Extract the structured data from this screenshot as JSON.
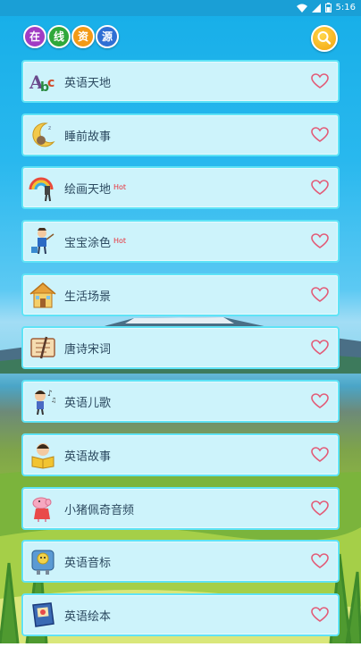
{
  "status": {
    "time": "5:16"
  },
  "header": {
    "logo_chars": [
      "在",
      "线",
      "资",
      "源"
    ],
    "logo_colors": [
      "#a13cc4",
      "#2fa83a",
      "#f29a16",
      "#2f6fd4"
    ]
  },
  "items": [
    {
      "label": "英语天地",
      "hot": "",
      "icon": "abc-letters-icon"
    },
    {
      "label": "睡前故事",
      "hot": "",
      "icon": "moon-sleep-icon"
    },
    {
      "label": "绘画天地",
      "hot": "Hot",
      "icon": "rainbow-paint-icon"
    },
    {
      "label": "宝宝涂色",
      "hot": "Hot",
      "icon": "child-paint-bucket-icon"
    },
    {
      "label": "生活场景",
      "hot": "",
      "icon": "house-icon"
    },
    {
      "label": "唐诗宋词",
      "hot": "",
      "icon": "scroll-icon"
    },
    {
      "label": "英语儿歌",
      "hot": "",
      "icon": "singing-child-icon"
    },
    {
      "label": "英语故事",
      "hot": "",
      "icon": "reading-child-icon"
    },
    {
      "label": "小猪佩奇音频",
      "hot": "",
      "icon": "peppa-pig-icon"
    },
    {
      "label": "英语音标",
      "hot": "",
      "icon": "robot-phonics-icon"
    },
    {
      "label": "英语绘本",
      "hot": "",
      "icon": "picture-book-icon"
    }
  ]
}
